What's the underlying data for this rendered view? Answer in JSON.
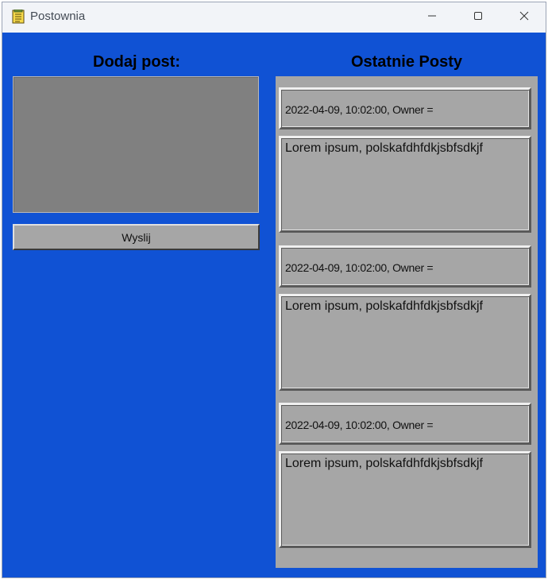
{
  "window": {
    "title": "Postownia",
    "icon": "notepad-icon",
    "controls": [
      "minimize-icon",
      "maximize-icon",
      "close-icon"
    ]
  },
  "left_panel": {
    "heading": "Dodaj post:",
    "input_value": "",
    "send_label": "Wyslij"
  },
  "right_panel": {
    "heading": "Ostatnie Posty",
    "posts": [
      {
        "meta": "2022-04-09, 10:02:00, Owner =",
        "body": "Lorem ipsum, polskafdhfdkjsbfsdkjf"
      },
      {
        "meta": "2022-04-09, 10:02:00, Owner =",
        "body": "Lorem ipsum, polskafdhfdkjsbfsdkjf"
      },
      {
        "meta": "2022-04-09, 10:02:00, Owner =",
        "body": "Lorem ipsum, polskafdhfdkjsbfsdkjf"
      }
    ]
  },
  "colors": {
    "background": "#1052d4",
    "panel": "#a6a6a6",
    "input": "#808080",
    "titlebar": "#f2f4f8"
  }
}
